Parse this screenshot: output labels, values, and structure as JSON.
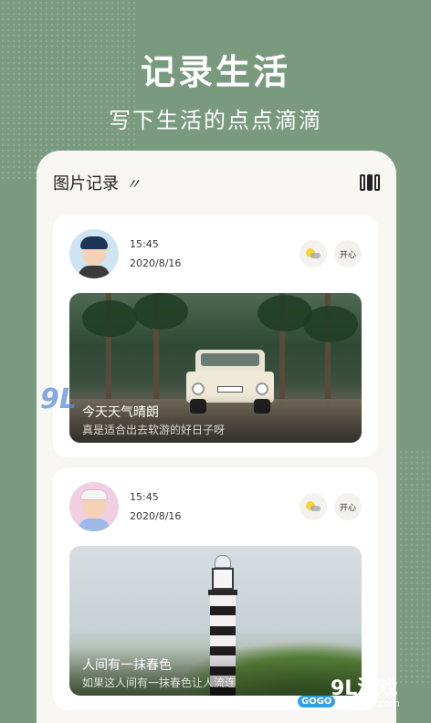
{
  "hero": {
    "title": "记录生活",
    "subtitle": "写下生活的点点滴滴"
  },
  "screen": {
    "header_title": "图片记录",
    "header_mark": "〃",
    "toggle_icon": "grid-toggle-icon"
  },
  "records": [
    {
      "time": "15:45",
      "date": "2020/8/16",
      "weather_icon": "sun-cloud-icon",
      "mood": "开心",
      "caption_title": "今天天气晴朗",
      "caption_text": "真是适合出去软游的好日子呀"
    },
    {
      "time": "15:45",
      "date": "2020/8/16",
      "weather_icon": "sun-cloud-icon",
      "mood": "开心",
      "caption_title": "人间有一抹春色",
      "caption_text": "如果这人间有一抹春色让人流连"
    }
  ],
  "watermarks": {
    "left": "9L",
    "right_big": "9L游戏",
    "right_small": "9ldanji.com",
    "right_badge": "GOGO"
  },
  "colors": {
    "background": "#7a9a80",
    "card": "#ffffff",
    "panel": "#f7f6f3"
  }
}
